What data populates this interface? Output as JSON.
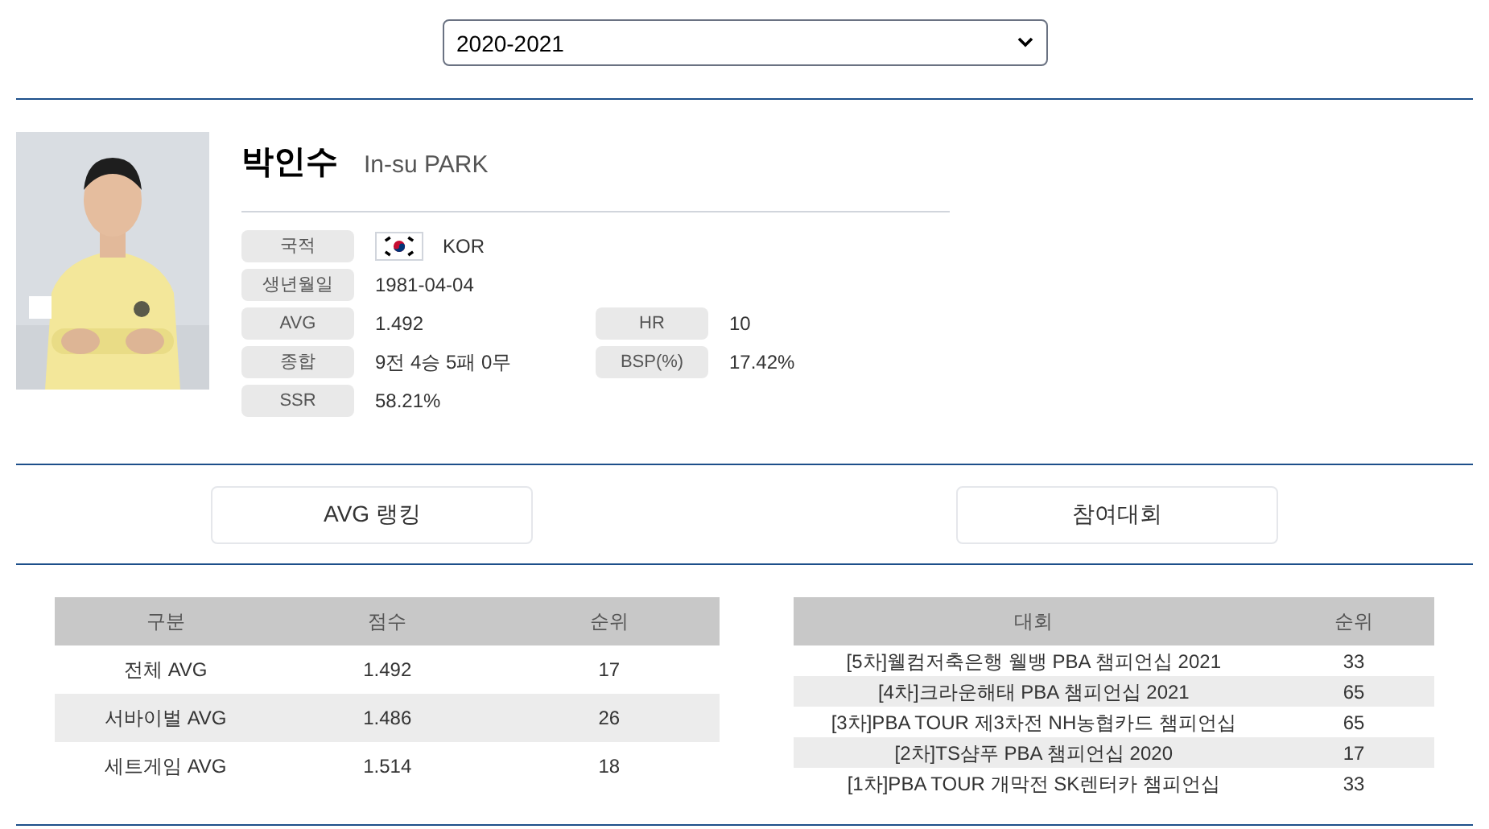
{
  "season_select": {
    "value": "2020-2021"
  },
  "player": {
    "name": "박인수",
    "name_en": "In-su PARK",
    "stat_rows": [
      {
        "cells": [
          {
            "label": "국적",
            "value": "KOR",
            "flag": true
          }
        ]
      },
      {
        "cells": [
          {
            "label": "생년월일",
            "value": "1981-04-04"
          }
        ]
      },
      {
        "cells": [
          {
            "label": "AVG",
            "value": "1.492"
          },
          {
            "label": "HR",
            "value": "10"
          }
        ]
      },
      {
        "cells": [
          {
            "label": "종합",
            "value": "9전 4승 5패 0무"
          },
          {
            "label": "BSP(%)",
            "value": "17.42%"
          }
        ]
      },
      {
        "cells": [
          {
            "label": "SSR",
            "value": "58.21%"
          }
        ]
      }
    ]
  },
  "section_buttons": [
    "AVG 랭킹",
    "참여대회"
  ],
  "ranking_table": {
    "columns": [
      "구분",
      "점수",
      "순위"
    ],
    "rows": [
      [
        "전체 AVG",
        "1.492",
        "17"
      ],
      [
        "서바이벌 AVG",
        "1.486",
        "26"
      ],
      [
        "세트게임 AVG",
        "1.514",
        "18"
      ]
    ]
  },
  "tournament_table": {
    "columns": [
      "대회",
      "순위"
    ],
    "rows": [
      [
        "[5차]웰컴저축은행 웰뱅 PBA 챔피언십 2021",
        "33"
      ],
      [
        "[4차]크라운해태 PBA 챔피언십 2021",
        "65"
      ],
      [
        "[3차]PBA TOUR 제3차전 NH농협카드 챔피언십",
        "65"
      ],
      [
        "[2차]TS샴푸 PBA 챔피언십 2020",
        "17"
      ],
      [
        "[1차]PBA TOUR 개막전 SK렌터카 챔피언십",
        "33"
      ]
    ]
  }
}
